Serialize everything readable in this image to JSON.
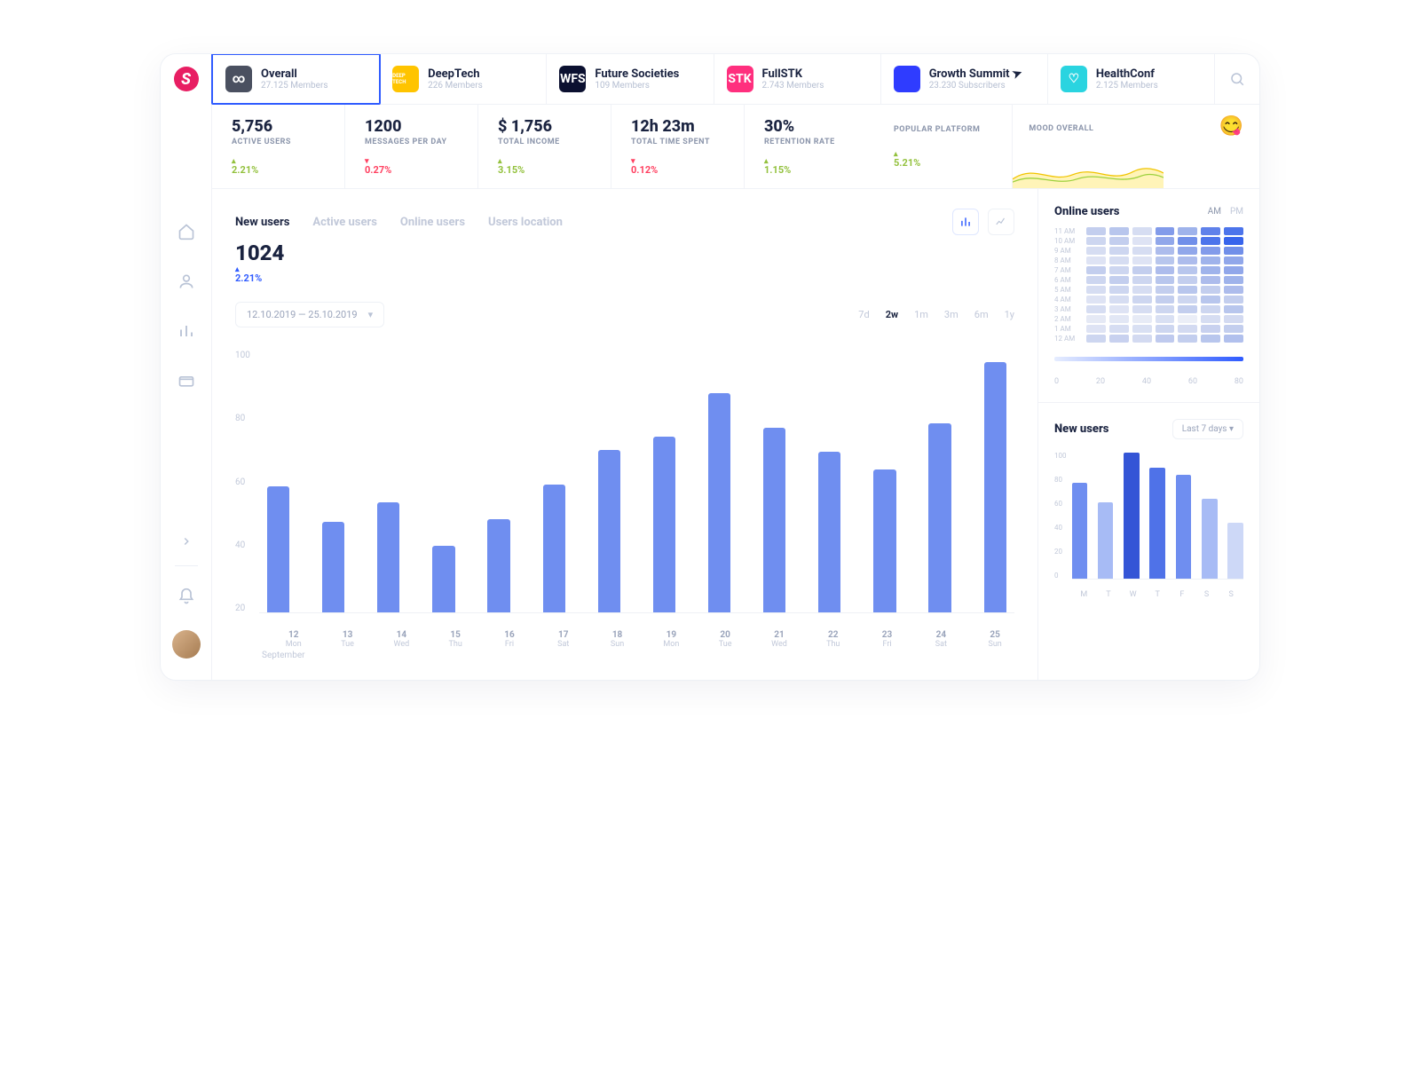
{
  "tabs": [
    {
      "title": "Overall",
      "sub": "27.125 Members",
      "logo_bg": "#4a5060",
      "logo_txt": "∞",
      "active": true
    },
    {
      "title": "DeepTech",
      "sub": "226 Members",
      "logo_bg": "#ffc400",
      "logo_txt": "DEEP TECH"
    },
    {
      "title": "Future Societies",
      "sub": "109 Members",
      "logo_bg": "#0b1030",
      "logo_txt": "WFS"
    },
    {
      "title": "FullSTK",
      "sub": "2.743 Members",
      "logo_bg": "#ff2f7e",
      "logo_txt": "STK"
    },
    {
      "title": "Growth Summit",
      "sub": "23.230 Subscribers",
      "logo_bg": "#2f3cff",
      "logo_txt": "",
      "cursor": true
    },
    {
      "title": "HealthConf",
      "sub": "2.125 Members",
      "logo_bg": "#2ad4e0",
      "logo_txt": "♡"
    }
  ],
  "stats": [
    {
      "val": "5,756",
      "lbl": "ACTIVE USERS",
      "chg": "2.21%",
      "dir": "up"
    },
    {
      "val": "1200",
      "lbl": "MESSAGES PER DAY",
      "chg": "0.27%",
      "dir": "dn"
    },
    {
      "val": "$ 1,756",
      "lbl": "TOTAL INCOME",
      "chg": "3.15%",
      "dir": "up"
    },
    {
      "val": "12h 23m",
      "lbl": "TOTAL TIME SPENT",
      "chg": "0.12%",
      "dir": "dn"
    },
    {
      "val": "30%",
      "lbl": "RETENTION RATE",
      "chg": "1.15%",
      "dir": "up"
    }
  ],
  "popular": {
    "lbl": "POPULAR PLATFORM",
    "chg": "5.21%",
    "icon": "apple"
  },
  "mood": {
    "lbl": "MOOD OVERALL",
    "emoji": "😋"
  },
  "main_tabs": [
    "New users",
    "Active users",
    "Online users",
    "Users location"
  ],
  "main_value": "1024",
  "main_change": "2.21%",
  "date_range": "12.10.2019 — 25.10.2019",
  "ranges": [
    "7d",
    "2w",
    "1m",
    "3m",
    "6m",
    "1y"
  ],
  "range_active": "2w",
  "chart_month": "September",
  "online": {
    "title": "Online users",
    "am": "AM",
    "pm": "PM"
  },
  "heat_rows": [
    "11 AM",
    "10 AM",
    "9 AM",
    "8 AM",
    "7 AM",
    "6 AM",
    "5 AM",
    "4 AM",
    "3 AM",
    "2 AM",
    "1 AM",
    "12 AM"
  ],
  "legend_ticks": [
    "0",
    "20",
    "40",
    "60",
    "80"
  ],
  "mini": {
    "title": "New users",
    "dd": "Last 7 days"
  },
  "chart_data": [
    {
      "type": "bar",
      "title": "New users",
      "ylim": [
        0,
        100
      ],
      "yticks": [
        100,
        80,
        60,
        40,
        20
      ],
      "categories": [
        {
          "n": "12",
          "d": "Mon"
        },
        {
          "n": "13",
          "d": "Tue"
        },
        {
          "n": "14",
          "d": "Wed"
        },
        {
          "n": "15",
          "d": "Thu"
        },
        {
          "n": "16",
          "d": "Fri"
        },
        {
          "n": "17",
          "d": "Sat"
        },
        {
          "n": "18",
          "d": "Sun"
        },
        {
          "n": "19",
          "d": "Mon"
        },
        {
          "n": "20",
          "d": "Tue"
        },
        {
          "n": "21",
          "d": "Wed"
        },
        {
          "n": "22",
          "d": "Thu"
        },
        {
          "n": "23",
          "d": "Fri"
        },
        {
          "n": "24",
          "d": "Sat"
        },
        {
          "n": "25",
          "d": "Sun"
        }
      ],
      "values": [
        58,
        42,
        51,
        31,
        43,
        59,
        75,
        81,
        101,
        85,
        74,
        66,
        87,
        115
      ]
    },
    {
      "type": "heatmap",
      "title": "Online users",
      "xlabel": "day",
      "ylabel": "hour",
      "legend_range": [
        0,
        80
      ],
      "rows": [
        "11 AM",
        "10 AM",
        "9 AM",
        "8 AM",
        "7 AM",
        "6 AM",
        "5 AM",
        "4 AM",
        "3 AM",
        "2 AM",
        "1 AM",
        "12 AM"
      ],
      "cols": 7,
      "values": [
        [
          30,
          35,
          20,
          55,
          45,
          65,
          70
        ],
        [
          25,
          30,
          15,
          50,
          60,
          70,
          75
        ],
        [
          20,
          25,
          20,
          40,
          50,
          55,
          60
        ],
        [
          15,
          20,
          15,
          35,
          40,
          45,
          50
        ],
        [
          30,
          25,
          30,
          40,
          35,
          45,
          50
        ],
        [
          25,
          30,
          25,
          35,
          30,
          40,
          45
        ],
        [
          20,
          25,
          20,
          30,
          35,
          30,
          40
        ],
        [
          15,
          20,
          25,
          30,
          25,
          35,
          30
        ],
        [
          20,
          15,
          20,
          25,
          30,
          25,
          35
        ],
        [
          10,
          12,
          8,
          18,
          5,
          20,
          22
        ],
        [
          15,
          20,
          18,
          25,
          22,
          28,
          30
        ],
        [
          25,
          28,
          22,
          32,
          30,
          35,
          38
        ]
      ]
    },
    {
      "type": "bar",
      "title": "New users (Last 7 days)",
      "ylim": [
        0,
        100
      ],
      "yticks": [
        100,
        80,
        60,
        40,
        20,
        0
      ],
      "categories": [
        "M",
        "T",
        "W",
        "T",
        "F",
        "S",
        "S"
      ],
      "values": [
        78,
        62,
        102,
        90,
        84,
        65,
        46
      ],
      "colors": [
        "#6f8ef0",
        "#a7bbf5",
        "#3455d6",
        "#4f72e8",
        "#6f8ef0",
        "#a7bbf5",
        "#cdd8f7"
      ]
    }
  ]
}
